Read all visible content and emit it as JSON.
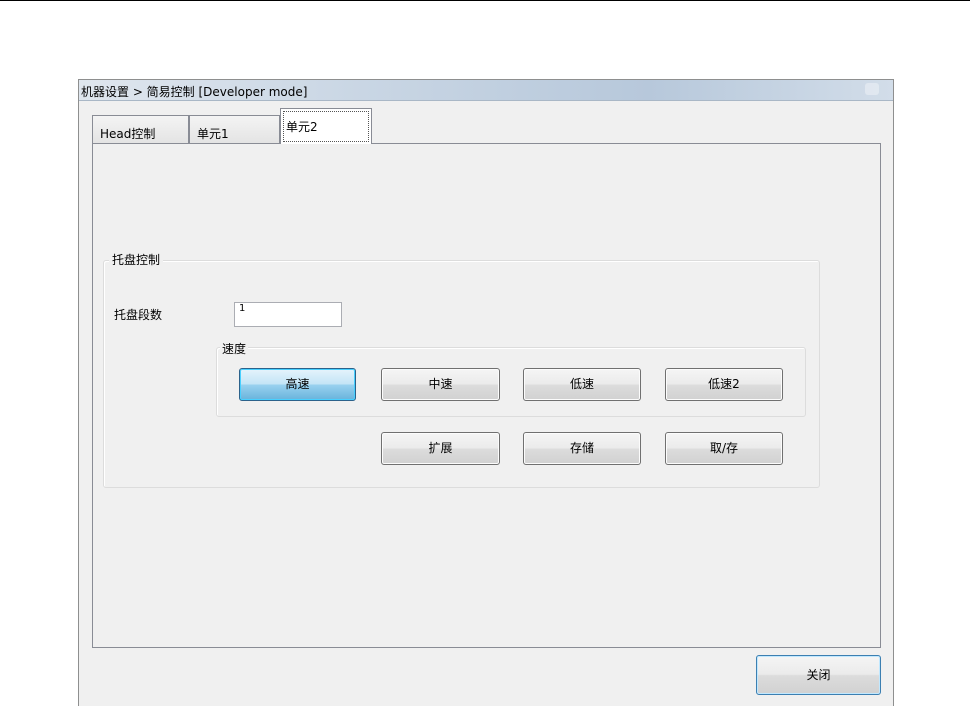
{
  "window": {
    "title": "机器设置 > 简易控制 [Developer mode]"
  },
  "tabs": [
    {
      "label": "Head控制",
      "selected": false
    },
    {
      "label": "单元1",
      "selected": false
    },
    {
      "label": "单元2",
      "selected": true
    }
  ],
  "tray_group": {
    "label": "托盘控制",
    "tray_count_label": "托盘段数",
    "tray_count_value": "1"
  },
  "speed_group": {
    "label": "速度",
    "buttons": [
      {
        "label": "高速",
        "active": true
      },
      {
        "label": "中速",
        "active": false
      },
      {
        "label": "低速",
        "active": false
      },
      {
        "label": "低速2",
        "active": false
      }
    ]
  },
  "actions": {
    "extend_label": "扩展",
    "store_label": "存储",
    "cancel_label": "取/存"
  },
  "footer": {
    "close_label": "关闭"
  }
}
